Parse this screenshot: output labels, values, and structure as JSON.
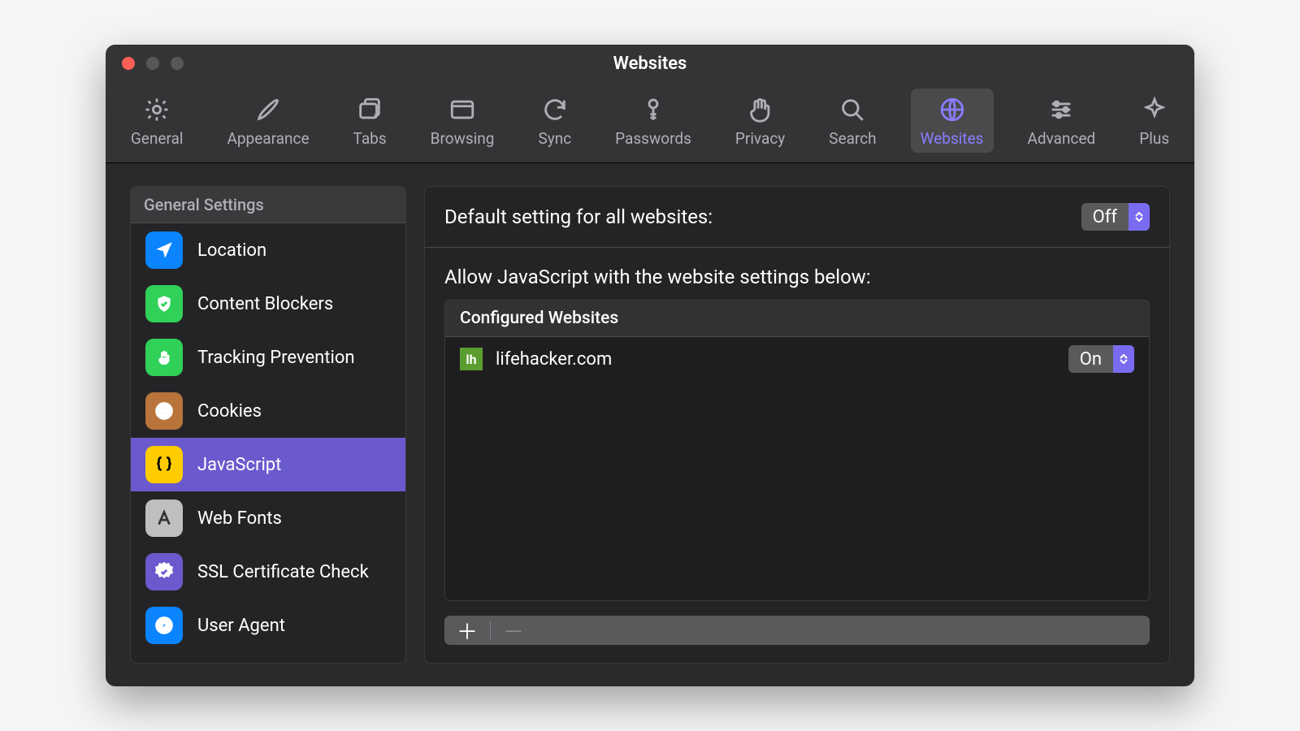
{
  "window": {
    "title": "Websites"
  },
  "traffic": {
    "close_color": "#ff5f57",
    "minimize_color": "#575759",
    "zoom_color": "#575759"
  },
  "toolbar": {
    "items": [
      {
        "id": "general",
        "label": "General"
      },
      {
        "id": "appearance",
        "label": "Appearance"
      },
      {
        "id": "tabs",
        "label": "Tabs"
      },
      {
        "id": "browsing",
        "label": "Browsing"
      },
      {
        "id": "sync",
        "label": "Sync"
      },
      {
        "id": "passwords",
        "label": "Passwords"
      },
      {
        "id": "privacy",
        "label": "Privacy"
      },
      {
        "id": "search",
        "label": "Search"
      },
      {
        "id": "websites",
        "label": "Websites"
      },
      {
        "id": "advanced",
        "label": "Advanced"
      },
      {
        "id": "plus",
        "label": "Plus"
      }
    ],
    "active_id": "websites"
  },
  "sidebar": {
    "header": "General Settings",
    "items": [
      {
        "id": "location",
        "label": "Location",
        "icon": "location-icon",
        "bg": "#0a84ff"
      },
      {
        "id": "blockers",
        "label": "Content Blockers",
        "icon": "shield-check-icon",
        "bg": "#30d158"
      },
      {
        "id": "tracking",
        "label": "Tracking Prevention",
        "icon": "hand-icon",
        "bg": "#30d158"
      },
      {
        "id": "cookies",
        "label": "Cookies",
        "icon": "cookie-icon",
        "bg": "#b8743a"
      },
      {
        "id": "javascript",
        "label": "JavaScript",
        "icon": "braces-icon",
        "bg": "#ffcc00",
        "selected": true
      },
      {
        "id": "webfonts",
        "label": "Web Fonts",
        "icon": "font-icon",
        "bg": "#bfbfbf"
      },
      {
        "id": "ssl",
        "label": "SSL Certificate Check",
        "icon": "badge-icon",
        "bg": "#6a5acd"
      },
      {
        "id": "useragent",
        "label": "User Agent",
        "icon": "compass-icon",
        "bg": "#0a84ff"
      }
    ]
  },
  "main": {
    "default_label": "Default setting for all websites:",
    "default_value": "Off",
    "subheader": "Allow JavaScript with the website settings below:",
    "table_header": "Configured Websites",
    "rows": [
      {
        "site": "lifehacker.com",
        "value": "On",
        "favicon_text": "lh",
        "favicon_bg": "#5a9e2f"
      }
    ]
  }
}
